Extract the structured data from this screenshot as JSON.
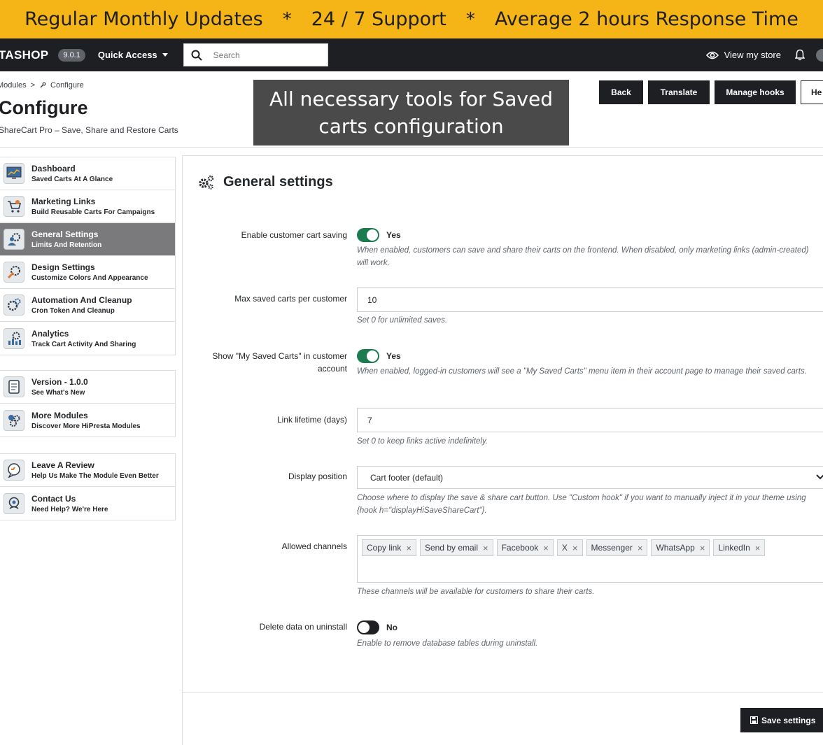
{
  "banner": {
    "item1": "Regular Monthly Updates",
    "sep": "*",
    "item2": "24 / 7 Support",
    "item3": "Average 2 hours Response Time"
  },
  "topbar": {
    "logo": "TASHOP",
    "version": "9.0.1",
    "quick_access": "Quick Access",
    "search_placeholder": "Search",
    "view_store": "View my store"
  },
  "header": {
    "breadcrumb_parent": "Modules",
    "breadcrumb_sep": ">",
    "breadcrumb_current": "Configure",
    "title": "Configure",
    "subtitle": "ShareCart Pro – Save, Share and Restore Carts",
    "caption": "All necessary tools for Saved carts configuration",
    "actions": {
      "back": "Back",
      "translate": "Translate",
      "manage_hooks": "Manage hooks",
      "help": "He"
    }
  },
  "sidebar": {
    "group1": [
      {
        "title": "Dashboard",
        "sub": "Saved Carts At A Glance",
        "icon": "dashboard-icon"
      },
      {
        "title": "Marketing Links",
        "sub": "Build Reusable Carts For Campaigns",
        "icon": "cart-link-icon"
      },
      {
        "title": "General Settings",
        "sub": "Limits And Retention",
        "icon": "settings-user-icon",
        "active": true
      },
      {
        "title": "Design Settings",
        "sub": "Customize Colors And Appearance",
        "icon": "design-brush-icon"
      },
      {
        "title": "Automation And Cleanup",
        "sub": "Cron Token And Cleanup",
        "icon": "automation-gear-icon"
      },
      {
        "title": "Analytics",
        "sub": "Track Cart Activity And Sharing",
        "icon": "analytics-chart-icon"
      }
    ],
    "group2": [
      {
        "title": "Version - 1.0.0",
        "sub": "See What's New",
        "icon": "changelog-icon"
      },
      {
        "title": "More Modules",
        "sub": "Discover More HiPresta Modules",
        "icon": "modules-puzzle-icon"
      }
    ],
    "group3": [
      {
        "title": "Leave A Review",
        "sub": "Help Us Make The Module Even Better",
        "icon": "review-chat-icon"
      },
      {
        "title": "Contact Us",
        "sub": "Need Help? We're Here",
        "icon": "support-icon"
      }
    ]
  },
  "panel": {
    "title": "General settings",
    "enable_saving": {
      "label": "Enable customer cart saving",
      "state": "Yes",
      "help": "When enabled, customers can save and share their carts on the frontend. When disabled, only marketing links (admin-created) will work."
    },
    "max_carts": {
      "label": "Max saved carts per customer",
      "value": "10",
      "help": "Set 0 for unlimited saves."
    },
    "show_my_carts": {
      "label": "Show \"My Saved Carts\" in customer account",
      "state": "Yes",
      "help": "When enabled, logged-in customers will see a \"My Saved Carts\" menu item in their account page to manage their saved carts."
    },
    "link_lifetime": {
      "label": "Link lifetime (days)",
      "value": "7",
      "help": "Set 0 to keep links active indefinitely."
    },
    "display_position": {
      "label": "Display position",
      "value": "Cart footer (default)",
      "help": "Choose where to display the save & share cart button. Use \"Custom hook\" if you want to manually inject it in your theme using {hook h=\"displayHiSaveShareCart\"}."
    },
    "channels": {
      "label": "Allowed channels",
      "tags": [
        "Copy link",
        "Send by email",
        "Facebook",
        "X",
        "Messenger",
        "WhatsApp",
        "LinkedIn"
      ],
      "remove_glyph": "×",
      "help": "These channels will be available for customers to share their carts."
    },
    "delete_data": {
      "label": "Delete data on uninstall",
      "state": "No",
      "help": "Enable to remove database tables during uninstall."
    },
    "save_button": "Save settings"
  }
}
